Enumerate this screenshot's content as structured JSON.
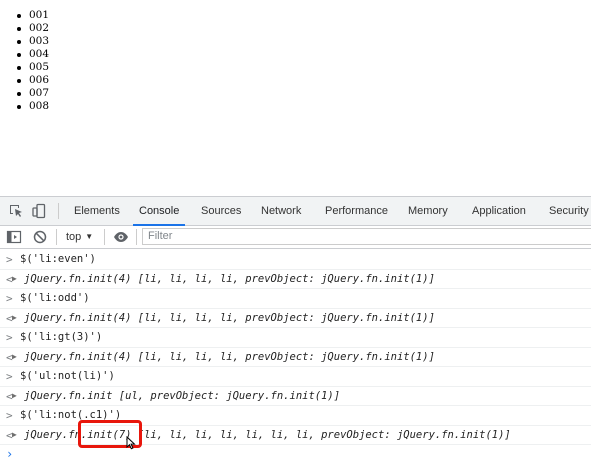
{
  "page": {
    "list_items": [
      "001",
      "002",
      "003",
      "004",
      "005",
      "006",
      "007",
      "008"
    ]
  },
  "devtools": {
    "tabs": [
      "Elements",
      "Console",
      "Sources",
      "Network",
      "Performance",
      "Memory",
      "Application",
      "Security"
    ],
    "active_tab": "Console",
    "icons": [
      "inspect-element-icon",
      "device-toolbar-icon"
    ],
    "context_selector": "top",
    "filter_placeholder": "Filter",
    "accent_color": "#1a73e8",
    "highlight_color": "#e8160c"
  },
  "console": {
    "entries": [
      {
        "input": "$('li:even')",
        "output": "jQuery.fn.init(4) [li, li, li, li, prevObject: jQuery.fn.init(1)]"
      },
      {
        "input": "$('li:odd')",
        "output": "jQuery.fn.init(4) [li, li, li, li, prevObject: jQuery.fn.init(1)]"
      },
      {
        "input": "$('li:gt(3)')",
        "output": "jQuery.fn.init(4) [li, li, li, li, prevObject: jQuery.fn.init(1)]"
      },
      {
        "input": "$('ul:not(li)')",
        "output": "jQuery.fn.init [ul, prevObject: jQuery.fn.init(1)]"
      },
      {
        "input": "$('li:not(.c1)')",
        "output": "jQuery.fn.init(7) [li, li, li, li, li, li, li, prevObject: jQuery.fn.init(1)]"
      }
    ],
    "prompt_symbol": "›"
  }
}
